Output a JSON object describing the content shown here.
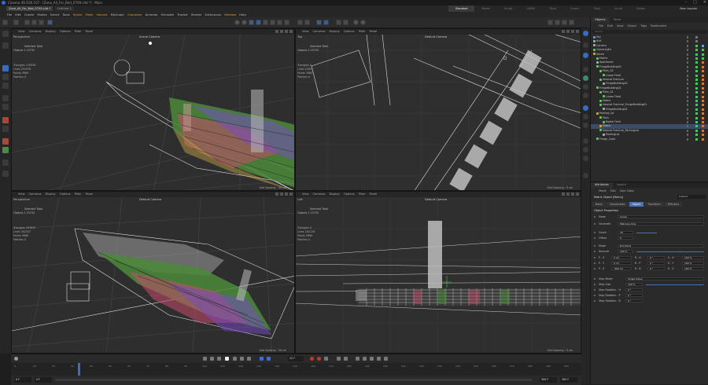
{
  "window": {
    "title": "Cinema 4D R26.107 - [Zone_All_For_Bed_0709.c4d *] - Main",
    "controls": [
      "–",
      "□",
      "✕"
    ]
  },
  "tabs": [
    {
      "label": "Zone_All_For_Bed_0709.c4d *",
      "active": true
    },
    {
      "label": "Untitled 1",
      "active": false
    }
  ],
  "layouts": [
    "Standard",
    "Model",
    "Sculpt",
    "UVEdit",
    "Paint",
    "Groom",
    "Track",
    "Script",
    "Nodes"
  ],
  "active_layout": "Standard",
  "new_layouts_label": "New Layouts",
  "menu": [
    "File",
    "Edit",
    "Create",
    "Modes",
    "Select",
    "Tools",
    "Spline",
    "Mesh",
    "Volume",
    "MoGraph",
    "Character",
    "Animate",
    "Simulate",
    "Tracker",
    "Render",
    "Extensions",
    "Window",
    "Help"
  ],
  "menu_highlight": [
    "Spline",
    "Mesh",
    "Volume",
    "Character"
  ],
  "viewports": [
    {
      "id": "perspective-top",
      "label": "Perspective",
      "camera": "Scene Camera",
      "menu": [
        "View",
        "Cameras",
        "Display",
        "Options",
        "Filter",
        "Panel"
      ],
      "selected_label": "Selected Total",
      "objects_line": "Objects   1      23732",
      "stats": [
        "Triangles  143936",
        "Lines   291978",
        "Points   9980",
        "Patches  0"
      ],
      "grid_spacing": "Grid Spacing : 50 cm"
    },
    {
      "id": "top",
      "label": "Top",
      "camera": "Default Camera",
      "menu": [
        "View",
        "Cameras",
        "Display",
        "Options",
        "Filter",
        "Panel"
      ],
      "selected_label": "Selected Total",
      "objects_line": "Objects   1      23732",
      "stats": [
        "Triangles  0",
        "Lines   22621",
        "Points   3980",
        "Patches  0"
      ],
      "grid_spacing": "Grid Spacing : 5 cm"
    },
    {
      "id": "perspective-bottom",
      "label": "Perspective",
      "camera": "Default Camera",
      "menu": [
        "View",
        "Cameras",
        "Display",
        "Options",
        "Filter",
        "Panel"
      ],
      "selected_label": "Selected Total",
      "objects_line": "Objects   1      23732",
      "stats": [
        "Triangles  163643",
        "Lines   302347",
        "Points   9980",
        "Patches  0"
      ],
      "grid_spacing": "Grid Spacing : 50 cm"
    },
    {
      "id": "left",
      "label": "Left",
      "camera": "Default Camera",
      "menu": [
        "View",
        "Cameras",
        "Display",
        "Options",
        "Filter",
        "Panel"
      ],
      "selected_label": "Selected Total",
      "objects_line": "Objects   1      23732",
      "stats": [
        "Triangles  0",
        "Lines   181128",
        "Points   9980",
        "Patches  0"
      ],
      "grid_spacing": "Grid Spacing : 5 cm"
    }
  ],
  "objects_panel": {
    "tabs": [
      "Objects",
      "Takes"
    ],
    "menu": [
      "File",
      "Edit",
      "View",
      "Object",
      "Tags",
      "Bookmarks"
    ],
    "search_placeholder": "Search",
    "rows": [
      {
        "name": "Sky",
        "indent": 0,
        "icon": "#6a9ad1",
        "sel": false,
        "tag": "none"
      },
      {
        "name": "Null",
        "indent": 0,
        "icon": "#aaaaaa",
        "sel": false,
        "tag": "none"
      },
      {
        "name": "Camera",
        "indent": 0,
        "icon": "#aaaaaa",
        "sel": false,
        "tag": "cam"
      },
      {
        "name": "ClonerLight",
        "indent": 0,
        "icon": "#6ac16a",
        "sel": false,
        "tag": "grn"
      },
      {
        "name": "Zones",
        "indent": 0,
        "icon": "#e0a040",
        "sel": false,
        "tag": "grn"
      },
      {
        "name": "Matrix",
        "indent": 1,
        "icon": "#6ac16a",
        "sel": false,
        "tag": "grn"
      },
      {
        "name": "Apartment",
        "indent": 1,
        "icon": "#aaaaaa",
        "sel": false,
        "tag": "org"
      },
      {
        "name": "FringeBuilding02",
        "indent": 1,
        "icon": "#6ac16a",
        "sel": false,
        "tag": "org"
      },
      {
        "name": "Plain_02",
        "indent": 2,
        "icon": "#6ac16a",
        "sel": false,
        "tag": "org"
      },
      {
        "name": "Linear Field",
        "indent": 3,
        "icon": "#6ac16a",
        "sel": false,
        "tag": "org"
      },
      {
        "name": "Voronoi Fracture",
        "indent": 2,
        "icon": "#6ac16a",
        "sel": false,
        "tag": "org"
      },
      {
        "name": "FringeBuilding02",
        "indent": 3,
        "icon": "#aaaaaa",
        "sel": false,
        "tag": "org"
      },
      {
        "name": "FringeBuilding01",
        "indent": 1,
        "icon": "#6ac16a",
        "sel": false,
        "tag": "org"
      },
      {
        "name": "Plain_01",
        "indent": 2,
        "icon": "#6ac16a",
        "sel": false,
        "tag": "org"
      },
      {
        "name": "Linear Field",
        "indent": 3,
        "icon": "#6ac16a",
        "sel": false,
        "tag": "org"
      },
      {
        "name": "Matrix",
        "indent": 2,
        "icon": "#6ac16a",
        "sel": false,
        "tag": "org"
      },
      {
        "name": "Voronoi Fracture_FringeBuilding01",
        "indent": 2,
        "icon": "#6ac16a",
        "sel": false,
        "tag": "org"
      },
      {
        "name": "FringeBuilding01",
        "indent": 3,
        "icon": "#aaaaaa",
        "sel": false,
        "tag": "org"
      },
      {
        "name": "Parking Lot",
        "indent": 1,
        "icon": "#e0a040",
        "sel": false,
        "tag": "org"
      },
      {
        "name": "Plain",
        "indent": 2,
        "icon": "#6ac16a",
        "sel": false,
        "tag": "org"
      },
      {
        "name": "Radial Field",
        "indent": 3,
        "icon": "#6ac16a",
        "sel": false,
        "tag": "org"
      },
      {
        "name": "Matrix",
        "indent": 2,
        "icon": "#e0a040",
        "sel": true,
        "tag": "org"
      },
      {
        "name": "Voronoi Fracture_ParkingLot",
        "indent": 2,
        "icon": "#6ac16a",
        "sel": false,
        "tag": "org"
      },
      {
        "name": "ParkingLot",
        "indent": 3,
        "icon": "#aaaaaa",
        "sel": false,
        "tag": "org"
      },
      {
        "name": "Fringe_Color",
        "indent": 1,
        "icon": "#6ac16a",
        "sel": false,
        "tag": "org"
      }
    ]
  },
  "attributes_panel": {
    "tabs": [
      "Attributes",
      "Layers"
    ],
    "menu": [
      "Mode",
      "Edit",
      "User Data"
    ],
    "object_name": "Matrix Object [Matrix]",
    "preset": "Custom",
    "subtabs": [
      "Basic",
      "Coordinates",
      "Object",
      "Transform",
      "Effectors"
    ],
    "active_subtab": "Object",
    "section": "Object Properties",
    "rows": [
      {
        "label": "Mode",
        "value": "Linear",
        "kind": "drop"
      },
      {
        "label": "Generate",
        "value": "Matrices Only",
        "kind": "drop"
      },
      {
        "label": "Count",
        "value": "10",
        "kind": "num"
      },
      {
        "label": "Offset",
        "value": "0",
        "kind": "num"
      },
      {
        "label": "Mode",
        "value": "End Point",
        "kind": "drop"
      },
      {
        "label": "Amount",
        "value": "100 %",
        "kind": "num"
      }
    ],
    "pos_rows": [
      {
        "axis": "P . X",
        "val": "0 cm",
        "raxis": "R . H",
        "rval": "0 °",
        "saxis": "S . X",
        "sval": "100 %"
      },
      {
        "axis": "P . Y",
        "val": "0 cm",
        "raxis": "R . P",
        "rval": "0 °",
        "saxis": "S . Y",
        "sval": "100 %"
      },
      {
        "axis": "P . Z",
        "val": "-300 cm",
        "raxis": "R . B",
        "rval": "0 °",
        "saxis": "S . Z",
        "sval": "100 %"
      }
    ],
    "step_rows": [
      {
        "label": "Step Mode",
        "value": "Single Value"
      },
      {
        "label": "Step Size",
        "value": "100 %"
      },
      {
        "label": "Step Rotation . H",
        "value": "0 °"
      },
      {
        "label": "Step Rotation . P",
        "value": "0 °"
      },
      {
        "label": "Step Rotation . B",
        "value": "0 °"
      }
    ]
  },
  "timeline": {
    "ticks": [
      "0",
      "10",
      "20",
      "30",
      "40",
      "50",
      "60",
      "70",
      "80",
      "90",
      "100",
      "110",
      "120",
      "130",
      "140",
      "150",
      "160",
      "170",
      "180",
      "190",
      "200",
      "210",
      "220",
      "230",
      "240",
      "250",
      "260",
      "270",
      "280",
      "290",
      "300"
    ],
    "current_frame": "22 F",
    "start_frame": "0 F",
    "start_frame2": "0 F",
    "end_frame": "300 F",
    "end_frame2": "300 F"
  },
  "colors": {
    "accent": "#3b6dd1",
    "highlight_menu": "#e89a2c",
    "selected_row": "#3b4c66"
  }
}
